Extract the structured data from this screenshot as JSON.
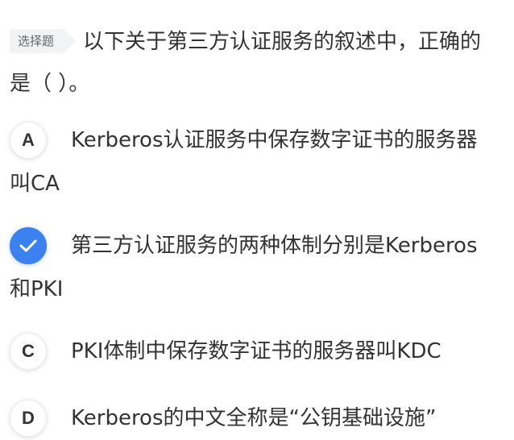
{
  "question": {
    "tag": "选择题",
    "text": "以下关于第三方认证服务的叙述中，正确的是（ ）。"
  },
  "options": [
    {
      "letter": "A",
      "text": "Kerberos认证服务中保存数字证书的服务器叫CA",
      "selected": false
    },
    {
      "letter": "",
      "text": "第三方认证服务的两种体制分别是Kerberos和PKI",
      "selected": true,
      "icon": "checkmark-icon"
    },
    {
      "letter": "C",
      "text": "PKI体制中保存数字证书的服务器叫KDC",
      "selected": false
    },
    {
      "letter": "D",
      "text": "Kerberos的中文全称是“公钥基础设施”",
      "selected": false
    }
  ],
  "colors": {
    "accent": "#3b82f0",
    "text": "#333333",
    "tag_bg": "#f2f3f5"
  }
}
